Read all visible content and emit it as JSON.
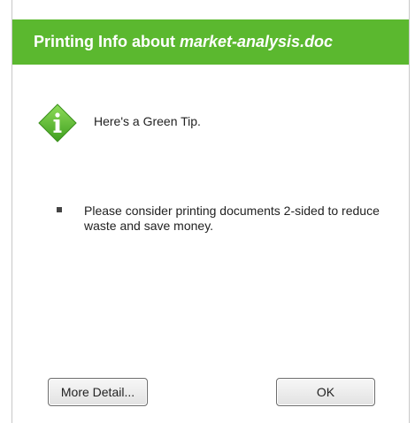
{
  "dialog": {
    "title_prefix": "Printing Info about",
    "title_filename": "market-analysis.doc",
    "tip_heading": "Here's a Green Tip.",
    "tip_icon": "info-icon",
    "tip_body": "Please consider printing documents 2-sided to reduce waste and save money.",
    "more_detail_label": "More Detail...",
    "ok_label": "OK"
  },
  "colors": {
    "title_bar": "#5bb82f",
    "icon_green": "#4caf2a"
  }
}
